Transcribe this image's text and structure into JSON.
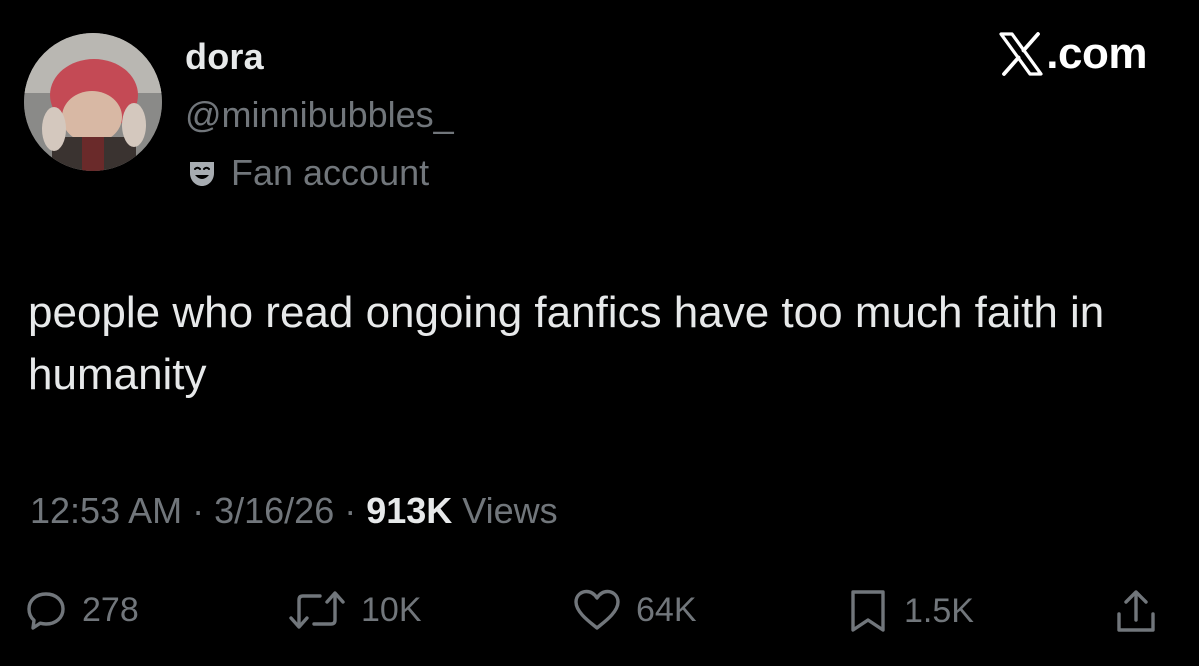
{
  "author": {
    "display_name": "dora",
    "handle": "@minnibubbles_",
    "label": "Fan account",
    "label_icon": "theater-mask-icon",
    "avatar": "avatar"
  },
  "brand": {
    "logo_icon": "x-logo-icon",
    "text": ".com"
  },
  "tweet": {
    "text": "people who read ongoing fanfics have too much faith in humanity"
  },
  "meta": {
    "time": "12:53 AM",
    "sep1": " · ",
    "date": "3/16/26",
    "sep2": " · ",
    "views_count": "913K",
    "views_label": " Views"
  },
  "actions": {
    "reply": {
      "icon": "reply-icon",
      "count": "278"
    },
    "retweet": {
      "icon": "retweet-icon",
      "count": "10K"
    },
    "like": {
      "icon": "heart-icon",
      "count": "64K"
    },
    "bookmark": {
      "icon": "bookmark-icon",
      "count": "1.5K"
    },
    "share": {
      "icon": "share-icon"
    }
  },
  "colors": {
    "background": "#000000",
    "primary_text": "#e7e9ea",
    "secondary_text": "#71767b"
  }
}
